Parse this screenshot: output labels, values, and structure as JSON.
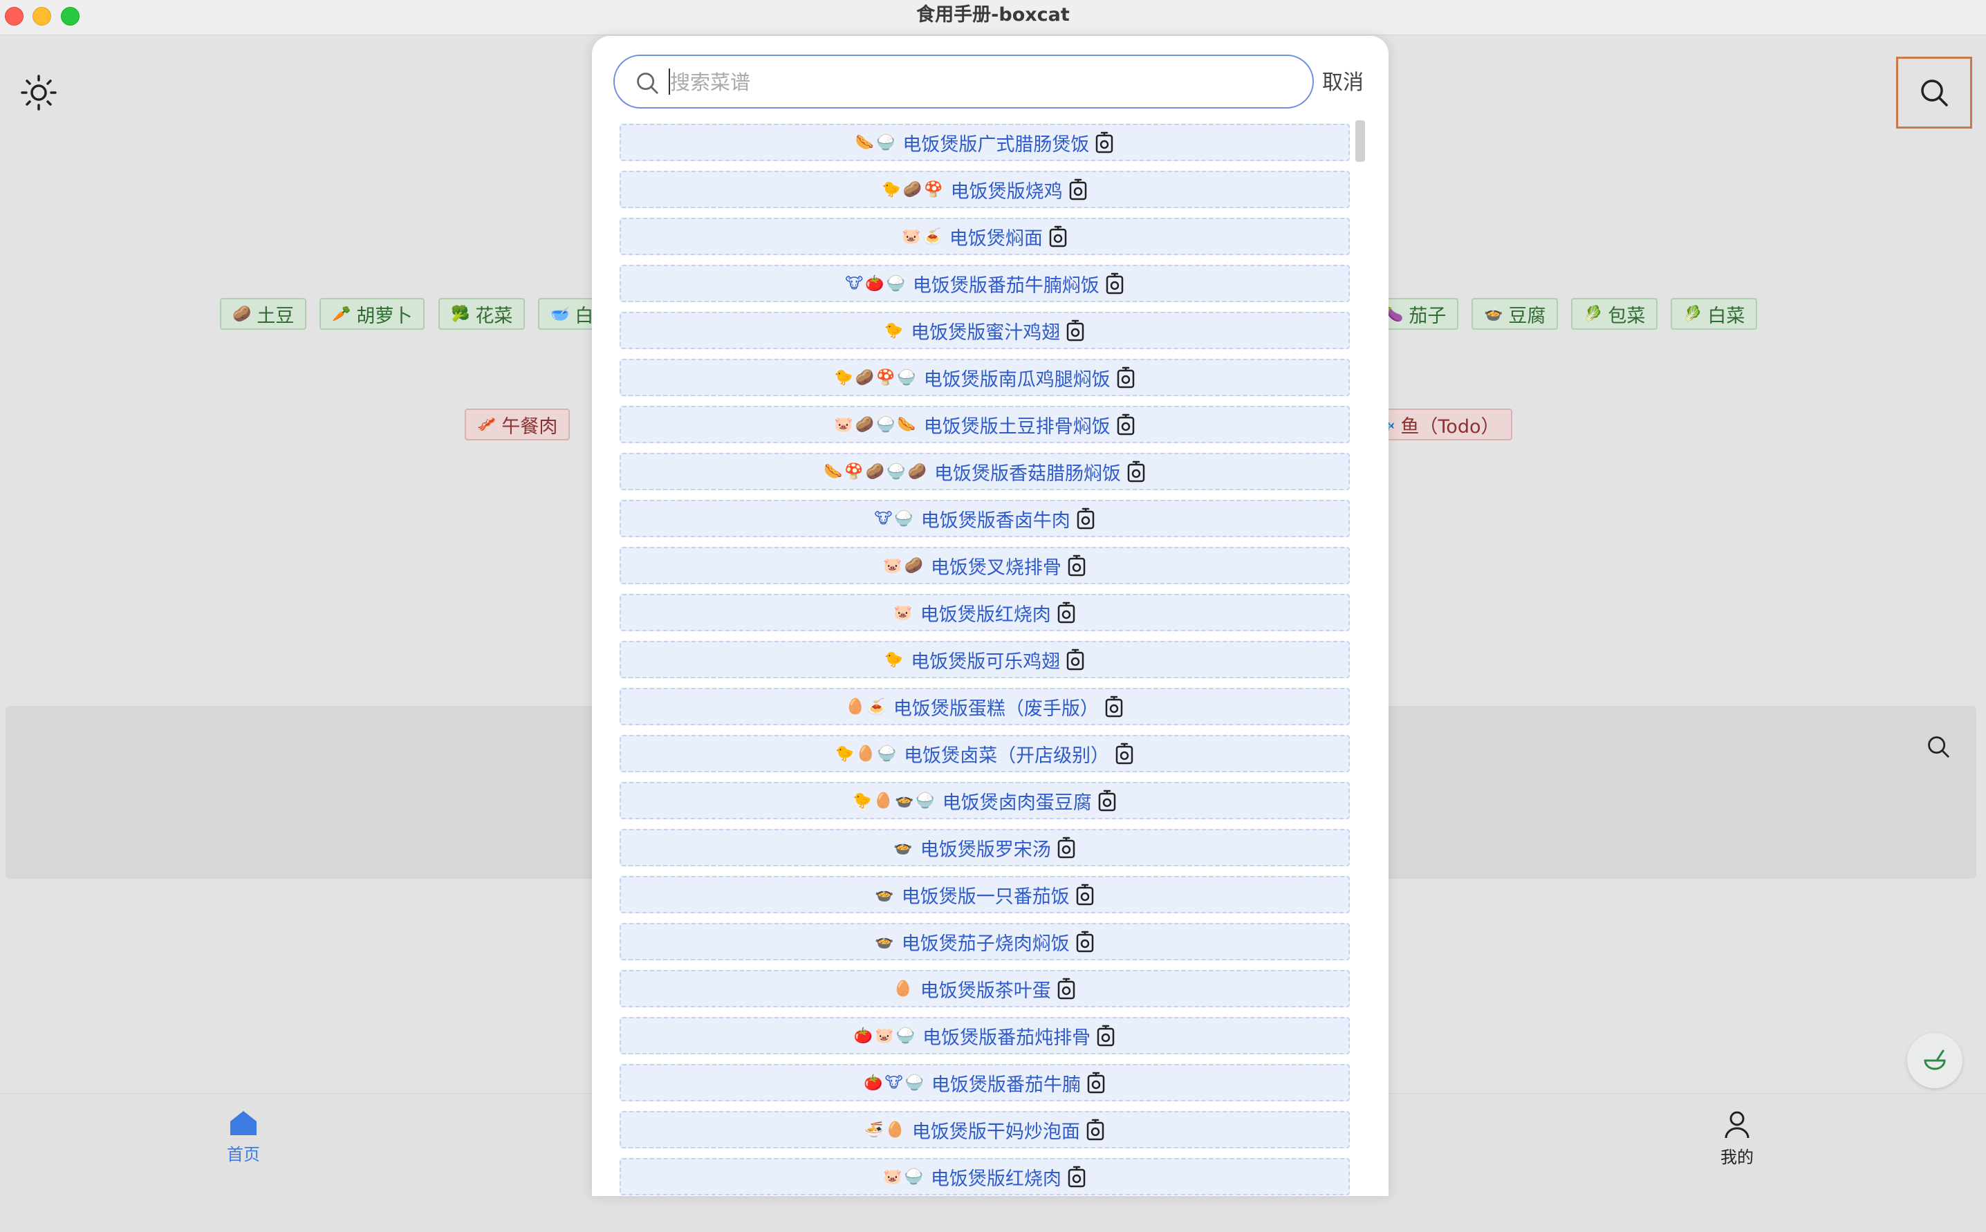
{
  "window": {
    "title": "食用手册-boxcat"
  },
  "colors": {
    "accent": "#3d7be3",
    "link": "#2e5bc9",
    "veg_chip": "#d6e6d6",
    "meat_chip": "#ecd6d6",
    "focus_outline": "#c9784a"
  },
  "background_app": {
    "veg_chips": [
      {
        "icon": "🥔",
        "label": "土豆"
      },
      {
        "icon": "🥕",
        "label": "胡萝卜"
      },
      {
        "icon": "🥦",
        "label": "花菜"
      },
      {
        "icon": "🥣",
        "label": "白"
      },
      {
        "icon": "🍆",
        "label": "茄子"
      },
      {
        "icon": "🍲",
        "label": "豆腐"
      },
      {
        "icon": "🥬",
        "label": "包菜"
      },
      {
        "icon": "🥬",
        "label": "白菜"
      }
    ],
    "meat_chips": [
      {
        "icon": "🥓",
        "label": "午餐肉"
      },
      {
        "icon": "🐟",
        "label": "鱼（Todo）"
      }
    ],
    "nav": {
      "home_label": "首页",
      "me_label": "我的"
    }
  },
  "search": {
    "placeholder": "搜索菜谱",
    "value": "",
    "cancel_label": "取消"
  },
  "recipes": [
    {
      "emoji": "🌭🍚",
      "name": "电饭煲版广式腊肠煲饭"
    },
    {
      "emoji": "🐤🥔🍄",
      "name": "电饭煲版烧鸡"
    },
    {
      "emoji": "🐷🍝",
      "name": "电饭煲焖面"
    },
    {
      "emoji": "🐮🍅🍚",
      "name": "电饭煲版番茄牛腩焖饭"
    },
    {
      "emoji": "🐤",
      "name": "电饭煲版蜜汁鸡翅"
    },
    {
      "emoji": "🐤🥔🍄🍚",
      "name": "电饭煲版南瓜鸡腿焖饭"
    },
    {
      "emoji": "🐷🥔🍚🌭",
      "name": "电饭煲版土豆排骨焖饭"
    },
    {
      "emoji": "🌭🍄🥔🍚🥔",
      "name": "电饭煲版香菇腊肠焖饭"
    },
    {
      "emoji": "🐮🍚",
      "name": "电饭煲版香卤牛肉"
    },
    {
      "emoji": "🐷🥔",
      "name": "电饭煲叉烧排骨"
    },
    {
      "emoji": "🐷",
      "name": "电饭煲版红烧肉"
    },
    {
      "emoji": "🐤",
      "name": "电饭煲版可乐鸡翅"
    },
    {
      "emoji": "🥚🍝",
      "name": "电饭煲版蛋糕（废手版）"
    },
    {
      "emoji": "🐤🥚🍚",
      "name": "电饭煲卤菜（开店级别）"
    },
    {
      "emoji": "🐤🥚🍲🍚",
      "name": "电饭煲卤肉蛋豆腐"
    },
    {
      "emoji": "🍲",
      "name": "电饭煲版罗宋汤"
    },
    {
      "emoji": "🍲",
      "name": "电饭煲版一只番茄饭"
    },
    {
      "emoji": "🍲",
      "name": "电饭煲茄子烧肉焖饭"
    },
    {
      "emoji": "🥚",
      "name": "电饭煲版茶叶蛋"
    },
    {
      "emoji": "🍅🐷🍚",
      "name": "电饭煲版番茄炖排骨"
    },
    {
      "emoji": "🍅🐮🍚",
      "name": "电饭煲版番茄牛腩"
    },
    {
      "emoji": "🍜🥚",
      "name": "电饭煲版干妈炒泡面"
    },
    {
      "emoji": "🐷🍚",
      "name": "电饭煲版红烧肉"
    }
  ]
}
